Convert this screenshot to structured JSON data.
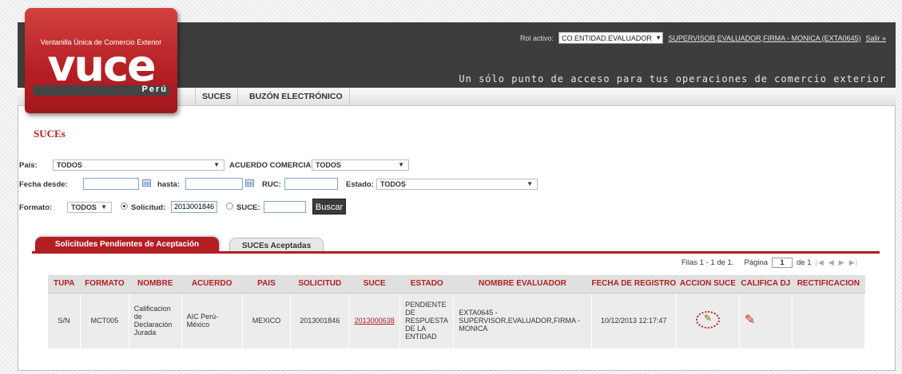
{
  "logo": {
    "tagline": "Ventanilla Única de Comercio Exterior",
    "word": "vuce",
    "country": "Perú"
  },
  "header": {
    "role_label": "Rol activo:",
    "role_value": "CO.ENTIDAD.EVALUADOR",
    "user_link": "SUPERVISOR,EVALUADOR,FIRMA - MONICA (EXTA0645)",
    "logout_link": "Salir »",
    "slogan": "Un sólo punto de acceso para tus operaciones de comercio exterior"
  },
  "nav": {
    "items": [
      "SUCES",
      "BUZÓN ELECTRÓNICO"
    ]
  },
  "page": {
    "title": "SUCEs"
  },
  "filters": {
    "pais_label": "País:",
    "pais_value": "TODOS",
    "acuerdo_label": "ACUERDO COMERCIAL:",
    "acuerdo_value": "TODOS",
    "fecha_desde_label": "Fecha desde:",
    "fecha_desde_value": "",
    "hasta_label": "hasta:",
    "hasta_value": "",
    "ruc_label": "RUC:",
    "ruc_value": "",
    "estado_label": "Estado:",
    "estado_value": "TODOS",
    "formato_label": "Formato:",
    "formato_value": "TODOS",
    "solicitud_label": "Solicitud:",
    "solicitud_value": "2013001846",
    "suce_label": "SUCE:",
    "suce_value": "",
    "buscar_label": "Buscar"
  },
  "tabs": [
    {
      "label": "Solicitudes Pendientes de Aceptación",
      "active": true
    },
    {
      "label": "SUCEs Aceptadas",
      "active": false
    }
  ],
  "pager": {
    "rows_text": "Filas 1 - 1 de 1.",
    "page_label": "Página",
    "page_value": "1",
    "of_text": "de 1"
  },
  "table": {
    "columns": [
      "TUPA",
      "FORMATO",
      "NOMBRE",
      "ACUERDO",
      "PAIS",
      "SOLICITUD",
      "SUCE",
      "ESTADO",
      "NOMBRE EVALUADOR",
      "FECHA DE REGISTRO",
      "ACCION SUCE",
      "CALIFICA DJ",
      "RECTIFICACION"
    ],
    "rows": [
      {
        "tupa": "S/N",
        "formato": "MCT005",
        "nombre": "Calificacion de Declaración Jurada",
        "acuerdo": "AIC Perú-México",
        "pais": "MEXICO",
        "solicitud": "2013001846",
        "suce": "2013000638",
        "estado": "PENDIENTE DE RESPUESTA DE LA ENTIDAD",
        "evaluador": "EXTA0645 - SUPERVISOR,EVALUADOR,FIRMA - MONICA",
        "fecha": "10/12/2013 12:17:47"
      }
    ]
  },
  "colors": {
    "brand_red": "#b31e22",
    "header_dark": "#3d3d3d"
  }
}
